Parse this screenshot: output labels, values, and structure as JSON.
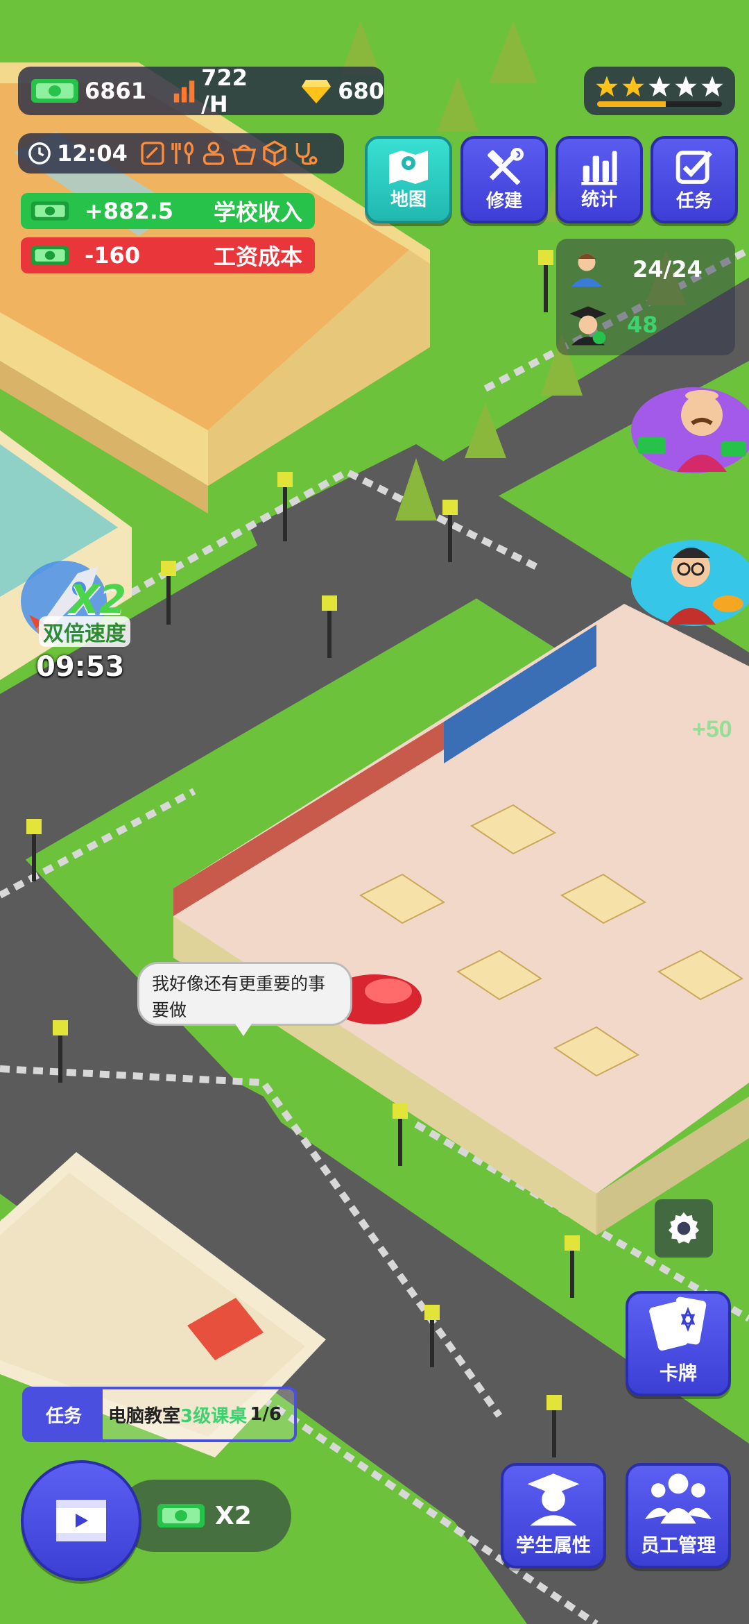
{
  "resources": {
    "cash": "6861",
    "income_rate": "722 /H",
    "gems": "680",
    "cash_icon": "cash-icon",
    "income_icon": "bar-chart-icon",
    "gem_icon": "diamond-icon"
  },
  "rating": {
    "stars_filled": 2,
    "stars_total": 5,
    "progress": 0.55
  },
  "clock": {
    "time": "12:04"
  },
  "facilities": [
    "board-icon",
    "dining-icon",
    "person-icon",
    "basket-icon",
    "box-icon",
    "stethoscope-icon"
  ],
  "menu": {
    "map_label": "地图",
    "build_label": "修建",
    "stats_label": "统计",
    "tasks_label": "任务"
  },
  "finance": {
    "income_value": "+882.5",
    "income_label": "学校收入",
    "cost_value": "-160",
    "cost_label": "工资成本"
  },
  "people": {
    "staff_count": "24/24",
    "graduates_count": "48"
  },
  "speed_boost": {
    "multiplier": "X2",
    "label": "双倍速度",
    "timer": "09:53"
  },
  "floating_income": "+50",
  "speech_bubble": "我好像还有更重要的事要做",
  "task": {
    "tag": "任务",
    "name": "电脑教室",
    "level": "3级课桌",
    "progress": "1/6"
  },
  "ad_reward": {
    "multiplier": "X2"
  },
  "buttons": {
    "cards_label": "卡牌",
    "student_label": "学生属性",
    "staff_label": "员工管理"
  },
  "colors": {
    "grass": "#6cc23a",
    "road": "#5a5a5a",
    "accent_blue": "#4a4fe0",
    "teal": "#2cc9c0",
    "income_green": "#26c24a",
    "cost_red": "#e8363a"
  }
}
